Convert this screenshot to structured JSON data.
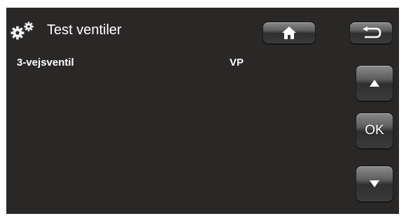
{
  "header": {
    "title": "Test ventiler",
    "icon": "gears-icon"
  },
  "toolbar": {
    "home_icon": "home-icon",
    "back_icon": "back-arrow-icon"
  },
  "list": {
    "rows": [
      {
        "label": "3-vejsventil",
        "value": "VP"
      }
    ]
  },
  "side_buttons": {
    "up_icon": "triangle-up-icon",
    "ok_label": "OK",
    "down_icon": "triangle-down-icon"
  },
  "colors": {
    "background": "#2a2727",
    "text": "#ffffff",
    "button": "#5e5e5e"
  }
}
